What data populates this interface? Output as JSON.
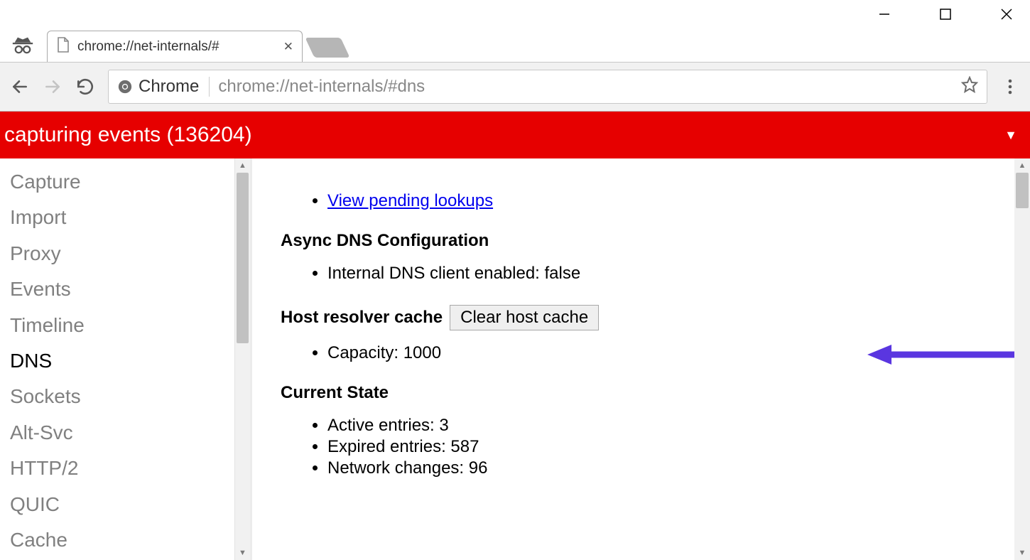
{
  "window": {
    "tab_title": "chrome://net-internals/#",
    "origin_label": "Chrome",
    "url": "chrome://net-internals/#dns"
  },
  "banner": {
    "text": "capturing events (136204)"
  },
  "sidebar": {
    "items": [
      {
        "label": "Capture",
        "active": false
      },
      {
        "label": "Import",
        "active": false
      },
      {
        "label": "Proxy",
        "active": false
      },
      {
        "label": "Events",
        "active": false
      },
      {
        "label": "Timeline",
        "active": false
      },
      {
        "label": "DNS",
        "active": true
      },
      {
        "label": "Sockets",
        "active": false
      },
      {
        "label": "Alt-Svc",
        "active": false
      },
      {
        "label": "HTTP/2",
        "active": false
      },
      {
        "label": "QUIC",
        "active": false
      },
      {
        "label": "Cache",
        "active": false
      }
    ]
  },
  "content": {
    "pending_link": "View pending lookups",
    "async_heading": "Async DNS Configuration",
    "async_item": "Internal DNS client enabled: false",
    "host_cache_heading": "Host resolver cache",
    "clear_button": "Clear host cache",
    "capacity_label": "Capacity: 1000",
    "current_state_heading": "Current State",
    "active_entries": "Active entries: 3",
    "expired_entries": "Expired entries: 587",
    "network_changes": "Network changes: 96"
  }
}
